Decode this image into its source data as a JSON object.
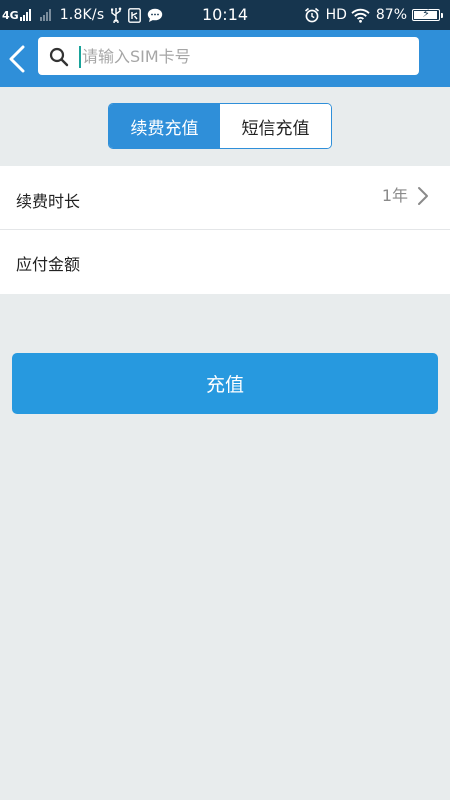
{
  "status_bar": {
    "network": "4G",
    "speed": "1.8K/s",
    "time": "10:14",
    "hd": "HD",
    "battery": "87%",
    "battery_level": 0.87,
    "icons": [
      "signal-icon",
      "signal-dim-icon",
      "usb-icon",
      "sim-tool-icon",
      "message-icon",
      "alarm-icon",
      "wifi-icon",
      "battery-charging-icon"
    ]
  },
  "header": {
    "back_icon": "chevron-left-icon",
    "search_icon": "search-icon",
    "search_placeholder": "请输入SIM卡号",
    "search_value": ""
  },
  "tabs": [
    {
      "label": "续费充值",
      "active": true
    },
    {
      "label": "短信充值",
      "active": false
    }
  ],
  "form": {
    "duration_label": "续费时长",
    "duration_value": "1年",
    "amount_label": "应付金额",
    "amount_value": ""
  },
  "submit_label": "充值",
  "colors": {
    "status_bar": "#16354e",
    "header": "#2f8fd9",
    "accent": "#2f8fd9",
    "button": "#2799df",
    "background": "#e8eced"
  }
}
